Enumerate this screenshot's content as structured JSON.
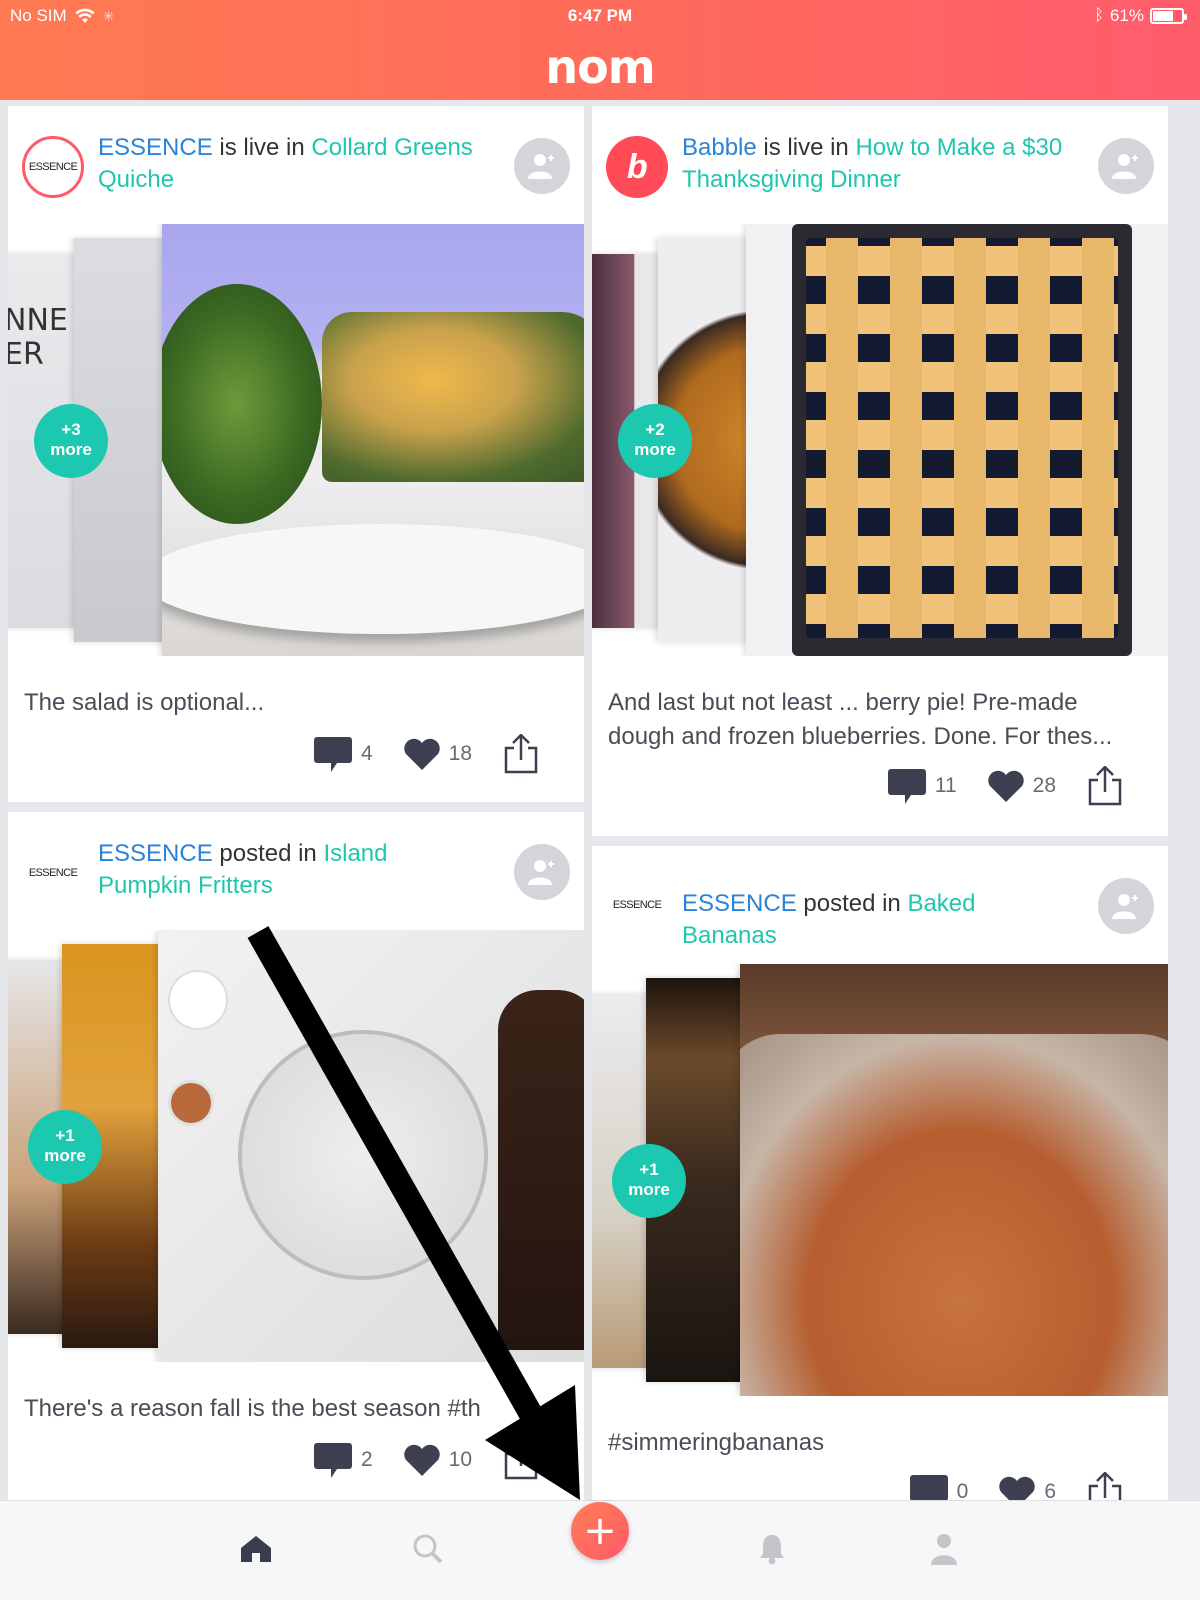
{
  "status_bar": {
    "carrier": "No SIM",
    "time": "6:47 PM",
    "battery": "61%"
  },
  "app": {
    "logo": "nom"
  },
  "posts": [
    {
      "avatar_text": "ESSENCE",
      "source": "ESSENCE",
      "verb": " is live in ",
      "topic": "Collard Greens Quiche",
      "more_top": "+3",
      "more_bottom": "more",
      "thumb_text": "NNE -AND ER",
      "caption": "The salad is optional...",
      "comments": "4",
      "likes": "18"
    },
    {
      "avatar_text": "b",
      "source": "Babble",
      "verb": " is live in ",
      "topic": "How to Make a $30 Thanksgiving Dinner",
      "more_top": "+2",
      "more_bottom": "more",
      "caption": "And last but not least ... berry pie! Pre-made dough and frozen blueberries. Done. For thes...",
      "comments": "11",
      "likes": "28"
    },
    {
      "avatar_text": "ESSENCE",
      "source": "ESSENCE",
      "verb": " posted in ",
      "topic": "Island Pumpkin Fritters",
      "more_top": "+1",
      "more_bottom": "more",
      "caption": "There's a reason fall is the best season #th",
      "comments": "2",
      "likes": "10"
    },
    {
      "avatar_text": "ESSENCE",
      "source": "ESSENCE",
      "verb": " posted in ",
      "topic": "Baked Bananas",
      "more_top": "+1",
      "more_bottom": "more",
      "caption": "#simmeringbananas",
      "comments": "0",
      "likes": "6"
    }
  ],
  "tabbar": {
    "add_label": "+"
  },
  "colors": {
    "brand": "#ff6a5c",
    "link": "#2a83d9",
    "topic": "#1fc6ad",
    "badge": "#1cc8b0"
  },
  "icons": [
    "wifi-icon",
    "bluetooth-icon",
    "battery-icon",
    "add-user-icon",
    "comment-icon",
    "heart-icon",
    "share-icon",
    "home-icon",
    "search-icon",
    "plus-icon",
    "bell-icon",
    "profile-icon"
  ]
}
